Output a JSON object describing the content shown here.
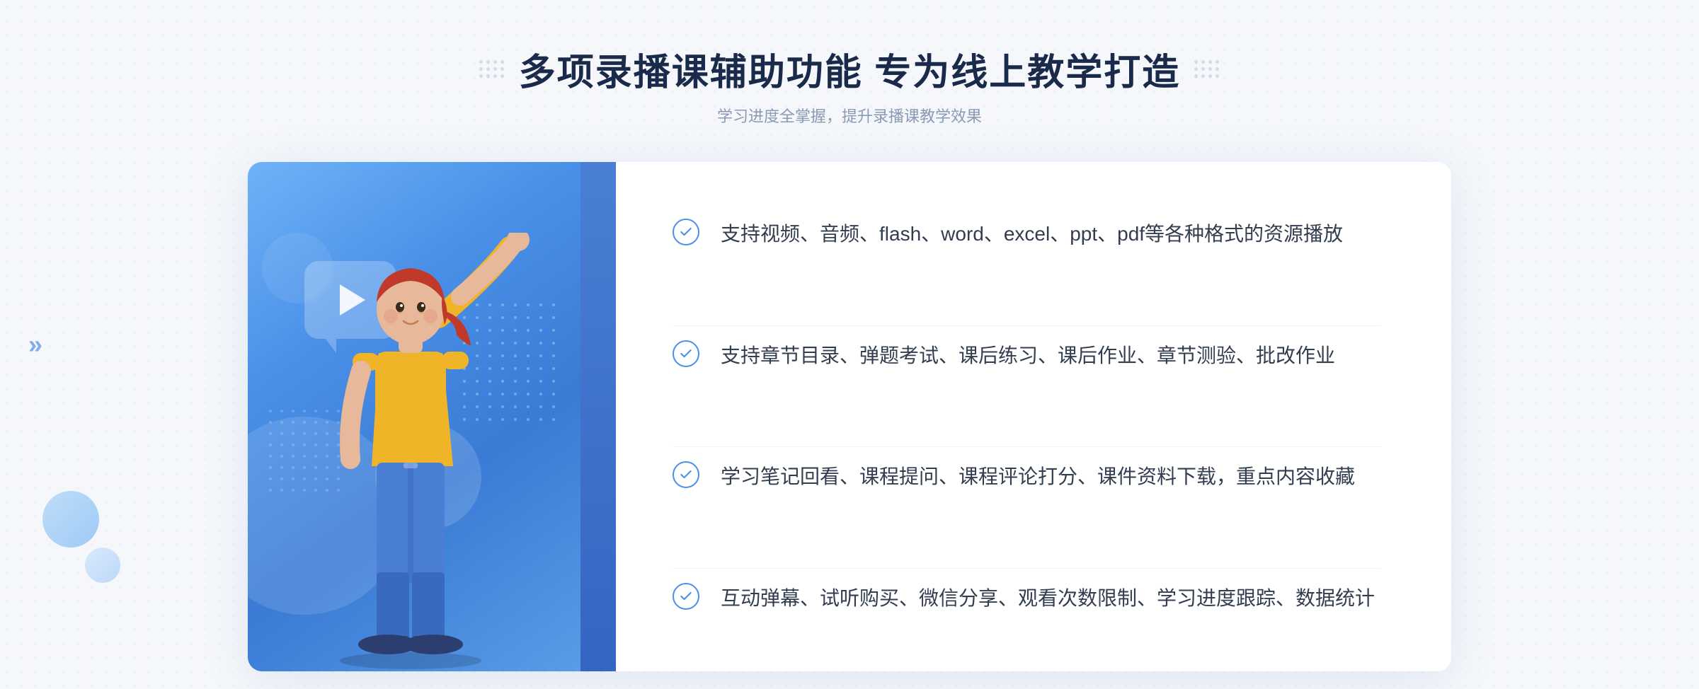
{
  "page": {
    "background_color": "#f5f7fa"
  },
  "header": {
    "title": "多项录播课辅助功能 专为线上教学打造",
    "subtitle": "学习进度全掌握，提升录播课教学效果"
  },
  "features": [
    {
      "id": 1,
      "text": "支持视频、音频、flash、word、excel、ppt、pdf等各种格式的资源播放"
    },
    {
      "id": 2,
      "text": "支持章节目录、弹题考试、课后练习、课后作业、章节测验、批改作业"
    },
    {
      "id": 3,
      "text": "学习笔记回看、课程提问、课程评论打分、课件资料下载，重点内容收藏"
    },
    {
      "id": 4,
      "text": "互动弹幕、试听购买、微信分享、观看次数限制、学习进度跟踪、数据统计"
    }
  ],
  "left_chevrons": "»",
  "check_icon_color": "#4a90e8"
}
